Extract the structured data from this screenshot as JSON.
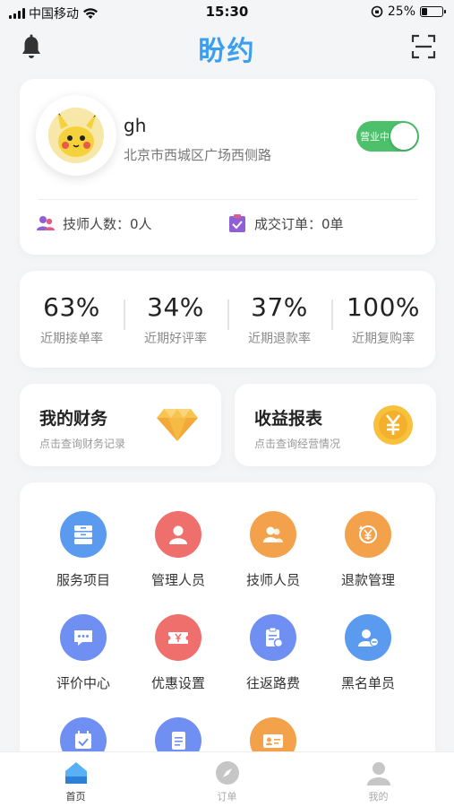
{
  "status_bar": {
    "carrier": "中国移动",
    "time": "15:30",
    "battery_text": "25%",
    "battery_level": 0.25
  },
  "header": {
    "logo_text": "盼约",
    "accent_color": "#3a9ff0"
  },
  "profile": {
    "name": "gh",
    "address": "北京市西城区广场西侧路",
    "toggle_label": "营业中",
    "toggle_on": true,
    "technician_count": "技师人数：0人",
    "orders_count": "成交订单：0单"
  },
  "metrics": [
    {
      "value": "63%",
      "label": "近期接单率"
    },
    {
      "value": "34%",
      "label": "近期好评率"
    },
    {
      "value": "37%",
      "label": "近期退款率"
    },
    {
      "value": "100%",
      "label": "近期复购率"
    }
  ],
  "finance": {
    "my_finance": {
      "title": "我的财务",
      "subtitle": "点击查询财务记录",
      "icon": "diamond-icon"
    },
    "revenue_report": {
      "title": "收益报表",
      "subtitle": "点击查询经营情况",
      "icon": "yen-coin-icon"
    }
  },
  "grid_items": [
    {
      "label": "服务项目",
      "icon": "drawer-icon",
      "color": "#5a9bf0"
    },
    {
      "label": "管理人员",
      "icon": "person-icon",
      "color": "#ef6f6c"
    },
    {
      "label": "技师人员",
      "icon": "people-icon",
      "color": "#f3a14a"
    },
    {
      "label": "退款管理",
      "icon": "refund-icon",
      "color": "#f3a14a"
    },
    {
      "label": "评价中心",
      "icon": "chat-icon",
      "color": "#6f8ff2"
    },
    {
      "label": "优惠设置",
      "icon": "coupon-icon",
      "color": "#ef6f6c"
    },
    {
      "label": "往返路费",
      "icon": "clipboard-icon",
      "color": "#6f8ff2"
    },
    {
      "label": "黑名单员",
      "icon": "blocked-user-icon",
      "color": "#5a9bf0"
    },
    {
      "label": "",
      "icon": "calendar-check-icon",
      "color": "#6f8ff2"
    },
    {
      "label": "",
      "icon": "document-icon",
      "color": "#6f8ff2"
    },
    {
      "label": "",
      "icon": "id-card-icon",
      "color": "#f3a14a"
    }
  ],
  "tab_bar": [
    {
      "label": "首页",
      "icon": "home-icon",
      "active": true
    },
    {
      "label": "订单",
      "icon": "compass-icon",
      "active": false
    },
    {
      "label": "我的",
      "icon": "user-icon",
      "active": false
    }
  ]
}
